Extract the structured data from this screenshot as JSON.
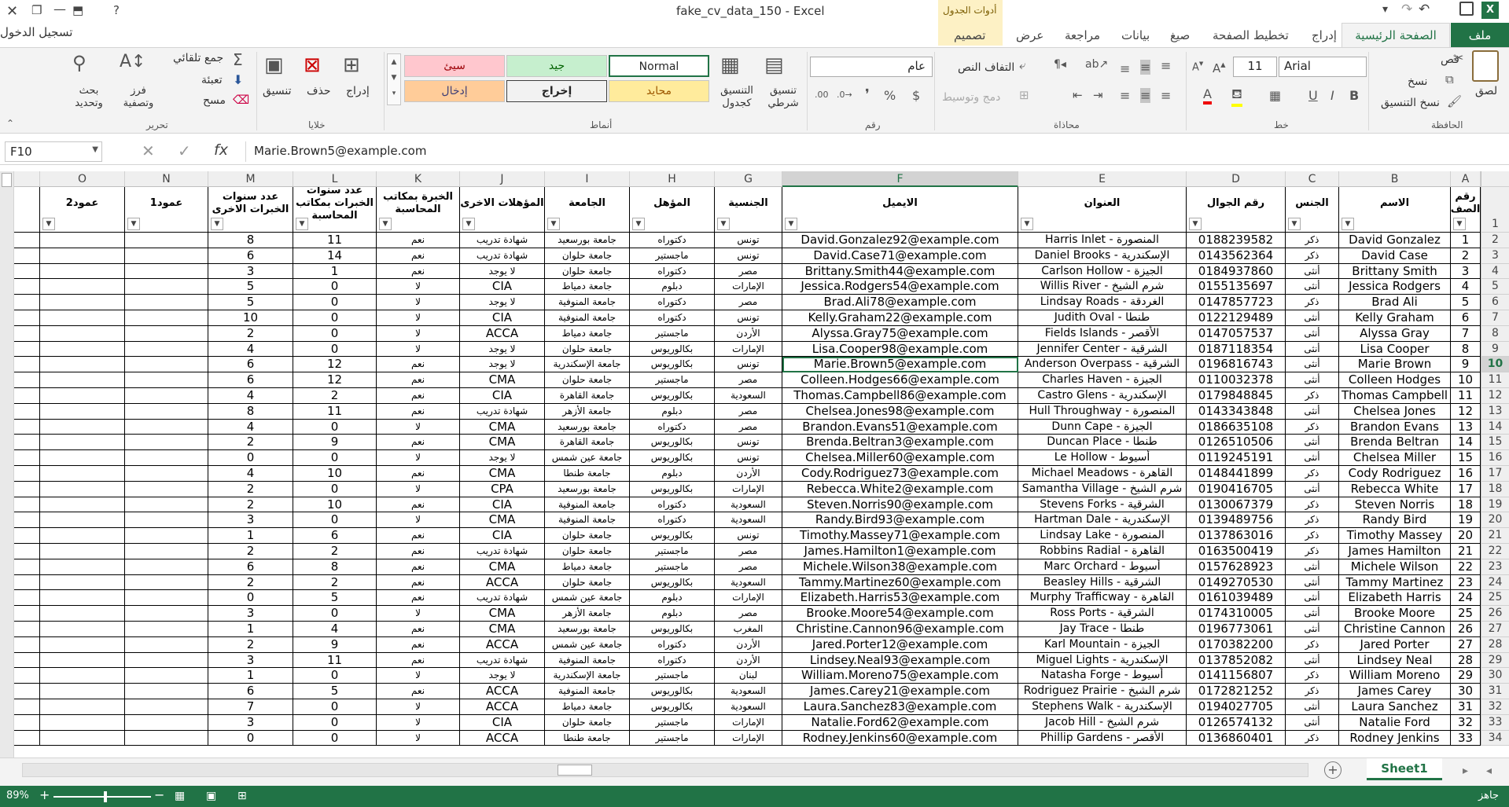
{
  "window": {
    "title": "fake_cv_data_150 - Excel",
    "signin": "تسجيل الدخول",
    "context_group": "أدوات الجدول",
    "help": "?"
  },
  "tabs": {
    "file": "ملف",
    "home": "الصفحة الرئيسية",
    "insert": "إدراج",
    "page_layout": "تخطيط الصفحة",
    "formulas": "صيغ",
    "data": "بيانات",
    "review": "مراجعة",
    "view": "عرض",
    "design": "تصميم"
  },
  "ribbon": {
    "clipboard": {
      "label": "الحافظة",
      "paste": "لصق",
      "cut": "قص",
      "copy": "نسخ",
      "format_painter": "نسخ التنسيق"
    },
    "font": {
      "label": "خط",
      "name": "Arial",
      "size": "11"
    },
    "alignment": {
      "label": "محاذاة",
      "wrap": "التفاف النص",
      "merge": "دمج وتوسيط"
    },
    "number": {
      "label": "رقم",
      "format": "عام"
    },
    "styles": {
      "label": "أنماط",
      "conditional": "تنسيق شرطي",
      "as_table": "التنسيق كجدول",
      "normal": "Normal",
      "bad": "سيئ",
      "good": "جيد",
      "neutral": "محايد",
      "output": "إخراج",
      "input": "إدخال"
    },
    "cells": {
      "label": "خلايا",
      "insert": "إدراج",
      "delete": "حذف",
      "format": "تنسيق"
    },
    "editing": {
      "label": "تحرير",
      "autosum": "جمع تلقائي",
      "fill": "تعبئة",
      "clear": "مسح",
      "sort": "فرز وتصفية",
      "find": "بحث وتحديد"
    }
  },
  "formula_bar": {
    "name_box": "F10",
    "content": "Marie.Brown5@example.com"
  },
  "columns": [
    "A",
    "B",
    "C",
    "D",
    "E",
    "F",
    "G",
    "H",
    "I",
    "J",
    "K",
    "L",
    "M",
    "N",
    "O"
  ],
  "selected_column": "F",
  "headers": {
    "A": "رقم الصف",
    "B": "الاسم",
    "C": "الجنس",
    "D": "رقم الجوال",
    "E": "العنوان",
    "F": "الايميل",
    "G": "الجنسية",
    "H": "المؤهل",
    "I": "الجامعة",
    "J": "المؤهلات الاخرى",
    "K": "الخبرة بمكاتب المحاسبة",
    "L": "عدد سنوات الخبرات بمكاتب المحاسبة",
    "M": "عدد سنوات الخبرات الاخرى",
    "N": "عمود1",
    "O": "عمود2"
  },
  "selected_row": 10,
  "rows": [
    [
      "1",
      "David Gonzalez",
      "ذكر",
      "0188239582",
      "Harris Inlet - المنصورة",
      "David.Gonzalez92@example.com",
      "تونس",
      "دكتوراه",
      "جامعة بورسعيد",
      "شهادة تدريب",
      "نعم",
      "11",
      "8"
    ],
    [
      "2",
      "David Case",
      "ذكر",
      "0143562364",
      "Daniel Brooks - الإسكندرية",
      "David.Case71@example.com",
      "تونس",
      "ماجستير",
      "جامعة حلوان",
      "شهادة تدريب",
      "نعم",
      "14",
      "6"
    ],
    [
      "3",
      "Brittany Smith",
      "أنثى",
      "0184937860",
      "Carlson Hollow - الجيزة",
      "Brittany.Smith44@example.com",
      "مصر",
      "دكتوراه",
      "جامعة حلوان",
      "لا يوجد",
      "نعم",
      "1",
      "3"
    ],
    [
      "4",
      "Jessica Rodgers",
      "أنثى",
      "0155135697",
      "Willis River - شرم الشيخ",
      "Jessica.Rodgers54@example.com",
      "الإمارات",
      "دبلوم",
      "جامعة دمياط",
      "CIA",
      "لا",
      "0",
      "5"
    ],
    [
      "5",
      "Brad Ali",
      "ذكر",
      "0147857723",
      "Lindsay Roads - الغردقة",
      "Brad.Ali78@example.com",
      "مصر",
      "دكتوراه",
      "جامعة المنوفية",
      "لا يوجد",
      "لا",
      "0",
      "5"
    ],
    [
      "6",
      "Kelly Graham",
      "أنثى",
      "0122129489",
      "Judith Oval - طنطا",
      "Kelly.Graham22@example.com",
      "تونس",
      "دكتوراه",
      "جامعة المنوفية",
      "CIA",
      "لا",
      "0",
      "10"
    ],
    [
      "7",
      "Alyssa Gray",
      "أنثى",
      "0147057537",
      "Fields Islands - الأقصر",
      "Alyssa.Gray75@example.com",
      "الأردن",
      "ماجستير",
      "جامعة دمياط",
      "ACCA",
      "لا",
      "0",
      "2"
    ],
    [
      "8",
      "Lisa Cooper",
      "أنثى",
      "0187118354",
      "Jennifer Center - الشرقية",
      "Lisa.Cooper98@example.com",
      "الإمارات",
      "بكالوريوس",
      "جامعة حلوان",
      "لا يوجد",
      "لا",
      "0",
      "4"
    ],
    [
      "9",
      "Marie Brown",
      "أنثى",
      "0196816743",
      "Anderson Overpass - الشرقية",
      "Marie.Brown5@example.com",
      "تونس",
      "بكالوريوس",
      "جامعة الإسكندرية",
      "لا يوجد",
      "نعم",
      "12",
      "6"
    ],
    [
      "10",
      "Colleen Hodges",
      "أنثى",
      "0110032378",
      "Charles Haven - الجيزة",
      "Colleen.Hodges66@example.com",
      "مصر",
      "ماجستير",
      "جامعة حلوان",
      "CMA",
      "نعم",
      "12",
      "6"
    ],
    [
      "11",
      "Thomas Campbell",
      "ذكر",
      "0179848845",
      "Castro Glens - الإسكندرية",
      "Thomas.Campbell86@example.com",
      "السعودية",
      "بكالوريوس",
      "جامعة القاهرة",
      "CIA",
      "نعم",
      "2",
      "4"
    ],
    [
      "12",
      "Chelsea Jones",
      "أنثى",
      "0143343848",
      "Hull Throughway - المنصورة",
      "Chelsea.Jones98@example.com",
      "مصر",
      "دبلوم",
      "جامعة الأزهر",
      "شهادة تدريب",
      "نعم",
      "11",
      "8"
    ],
    [
      "13",
      "Brandon Evans",
      "ذكر",
      "0186635108",
      "Dunn Cape - الجيزة",
      "Brandon.Evans51@example.com",
      "مصر",
      "دكتوراه",
      "جامعة بورسعيد",
      "CMA",
      "لا",
      "0",
      "4"
    ],
    [
      "14",
      "Brenda Beltran",
      "أنثى",
      "0126510506",
      "Duncan Place - طنطا",
      "Brenda.Beltran3@example.com",
      "تونس",
      "بكالوريوس",
      "جامعة القاهرة",
      "CMA",
      "نعم",
      "9",
      "2"
    ],
    [
      "15",
      "Chelsea Miller",
      "أنثى",
      "0119245191",
      "Le Hollow - أسيوط",
      "Chelsea.Miller60@example.com",
      "تونس",
      "بكالوريوس",
      "جامعة عين شمس",
      "لا يوجد",
      "لا",
      "0",
      "0"
    ],
    [
      "16",
      "Cody Rodriguez",
      "ذكر",
      "0148441899",
      "Michael Meadows - القاهرة",
      "Cody.Rodriguez73@example.com",
      "الأردن",
      "دبلوم",
      "جامعة طنطا",
      "CMA",
      "نعم",
      "10",
      "4"
    ],
    [
      "17",
      "Rebecca White",
      "أنثى",
      "0190416705",
      "Samantha Village - شرم الشيخ",
      "Rebecca.White2@example.com",
      "الإمارات",
      "بكالوريوس",
      "جامعة بورسعيد",
      "CPA",
      "لا",
      "0",
      "2"
    ],
    [
      "18",
      "Steven Norris",
      "ذكر",
      "0130067379",
      "Stevens Forks - الشرقية",
      "Steven.Norris90@example.com",
      "السعودية",
      "دكتوراه",
      "جامعة المنوفية",
      "CIA",
      "نعم",
      "10",
      "2"
    ],
    [
      "19",
      "Randy Bird",
      "ذكر",
      "0139489756",
      "Hartman Dale - الإسكندرية",
      "Randy.Bird93@example.com",
      "السعودية",
      "دكتوراه",
      "جامعة المنوفية",
      "CMA",
      "لا",
      "0",
      "3"
    ],
    [
      "20",
      "Timothy Massey",
      "ذكر",
      "0137863016",
      "Lindsay Lake - المنصورة",
      "Timothy.Massey71@example.com",
      "تونس",
      "بكالوريوس",
      "جامعة حلوان",
      "CIA",
      "نعم",
      "6",
      "1"
    ],
    [
      "21",
      "James Hamilton",
      "ذكر",
      "0163500419",
      "Robbins Radial - القاهرة",
      "James.Hamilton1@example.com",
      "مصر",
      "ماجستير",
      "جامعة حلوان",
      "شهادة تدريب",
      "نعم",
      "2",
      "2"
    ],
    [
      "22",
      "Michele Wilson",
      "أنثى",
      "0157628923",
      "Marc Orchard - أسيوط",
      "Michele.Wilson38@example.com",
      "مصر",
      "ماجستير",
      "جامعة دمياط",
      "CMA",
      "نعم",
      "8",
      "6"
    ],
    [
      "23",
      "Tammy Martinez",
      "أنثى",
      "0149270530",
      "Beasley Hills - الشرقية",
      "Tammy.Martinez60@example.com",
      "السعودية",
      "بكالوريوس",
      "جامعة حلوان",
      "ACCA",
      "نعم",
      "2",
      "2"
    ],
    [
      "24",
      "Elizabeth Harris",
      "أنثى",
      "0161039489",
      "Murphy Trafficway - القاهرة",
      "Elizabeth.Harris53@example.com",
      "الإمارات",
      "دبلوم",
      "جامعة عين شمس",
      "شهادة تدريب",
      "نعم",
      "5",
      "0"
    ],
    [
      "25",
      "Brooke Moore",
      "أنثى",
      "0174310005",
      "Ross Ports - الشرقية",
      "Brooke.Moore54@example.com",
      "مصر",
      "دبلوم",
      "جامعة الأزهر",
      "CMA",
      "لا",
      "0",
      "3"
    ],
    [
      "26",
      "Christine Cannon",
      "أنثى",
      "0196773061",
      "Jay Trace - طنطا",
      "Christine.Cannon96@example.com",
      "المغرب",
      "بكالوريوس",
      "جامعة بورسعيد",
      "CMA",
      "نعم",
      "4",
      "1"
    ],
    [
      "27",
      "Jared Porter",
      "ذكر",
      "0170382200",
      "Karl Mountain - الجيزة",
      "Jared.Porter12@example.com",
      "الأردن",
      "دكتوراه",
      "جامعة عين شمس",
      "ACCA",
      "نعم",
      "9",
      "2"
    ],
    [
      "28",
      "Lindsey Neal",
      "أنثى",
      "0137852082",
      "Miguel Lights - الإسكندرية",
      "Lindsey.Neal93@example.com",
      "الأردن",
      "دكتوراه",
      "جامعة المنوفية",
      "شهادة تدريب",
      "نعم",
      "11",
      "3"
    ],
    [
      "29",
      "William Moreno",
      "ذكر",
      "0141156807",
      "Natasha Forge - أسيوط",
      "William.Moreno75@example.com",
      "لبنان",
      "ماجستير",
      "جامعة الإسكندرية",
      "لا يوجد",
      "لا",
      "0",
      "1"
    ],
    [
      "30",
      "James Carey",
      "ذكر",
      "0172821252",
      "Rodriguez Prairie - شرم الشيخ",
      "James.Carey21@example.com",
      "السعودية",
      "بكالوريوس",
      "جامعة المنوفية",
      "ACCA",
      "نعم",
      "5",
      "6"
    ],
    [
      "31",
      "Laura Sanchez",
      "أنثى",
      "0194027705",
      "Stephens Walk - الإسكندرية",
      "Laura.Sanchez83@example.com",
      "السعودية",
      "بكالوريوس",
      "جامعة دمياط",
      "ACCA",
      "لا",
      "0",
      "7"
    ],
    [
      "32",
      "Natalie Ford",
      "أنثى",
      "0126574132",
      "Jacob Hill - شرم الشيخ",
      "Natalie.Ford62@example.com",
      "الإمارات",
      "ماجستير",
      "جامعة حلوان",
      "CIA",
      "لا",
      "0",
      "3"
    ],
    [
      "33",
      "Rodney Jenkins",
      "ذكر",
      "0136860401",
      "Phillip Gardens - الأقصر",
      "Rodney.Jenkins60@example.com",
      "الإمارات",
      "ماجستير",
      "جامعة طنطا",
      "ACCA",
      "لا",
      "0",
      "0"
    ]
  ],
  "sheet_tab": "Sheet1",
  "status": {
    "ready": "جاهز",
    "zoom": "89%"
  },
  "colors": {
    "excel_green": "#217346",
    "ribbon_bg": "#f3f3f3",
    "context_tab": "#fdf1c5",
    "style_bad": "#ffc7ce",
    "style_good": "#c6efce",
    "style_neutral": "#ffeb9c",
    "style_input": "#ffcc99",
    "style_output": "#f2f2f2"
  }
}
